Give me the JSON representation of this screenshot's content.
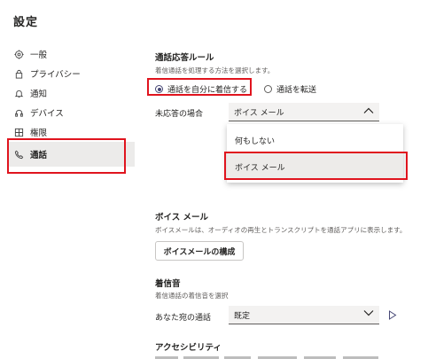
{
  "page": {
    "title": "設定"
  },
  "sidebar": {
    "items": [
      {
        "label": "一般",
        "icon": "gear-icon"
      },
      {
        "label": "プライバシー",
        "icon": "lock-icon"
      },
      {
        "label": "通知",
        "icon": "bell-icon"
      },
      {
        "label": "デバイス",
        "icon": "headset-icon"
      },
      {
        "label": "権限",
        "icon": "grid-icon"
      },
      {
        "label": "通話",
        "icon": "phone-icon",
        "active": true
      }
    ]
  },
  "call_answer_rules": {
    "title": "通話応答ルール",
    "description": "着信通話を処理する方法を選択します。",
    "options": [
      {
        "label": "通話を自分に着信する",
        "checked": true
      },
      {
        "label": "通話を転送",
        "checked": false
      }
    ],
    "unanswered_label": "未応答の場合",
    "unanswered_value": "ボイス メール",
    "dropdown_options": [
      "何もしない",
      "ボイス メール"
    ],
    "dropdown_selected": "ボイス メール"
  },
  "voicemail": {
    "title": "ボイス メール",
    "description": "ボイスメールは、オーディオの再生とトランスクリプトを通話アプリに表示します。",
    "button_label": "ボイスメールの構成"
  },
  "ringtone": {
    "title": "着信音",
    "description": "着信通話の着信音を選択",
    "field_label": "あなた宛の通話",
    "value": "既定"
  },
  "accessibility": {
    "title": "アクセシビリティ"
  },
  "colors": {
    "highlight": "#e0141e",
    "accent": "#464775",
    "active_bg": "#ecebea"
  }
}
